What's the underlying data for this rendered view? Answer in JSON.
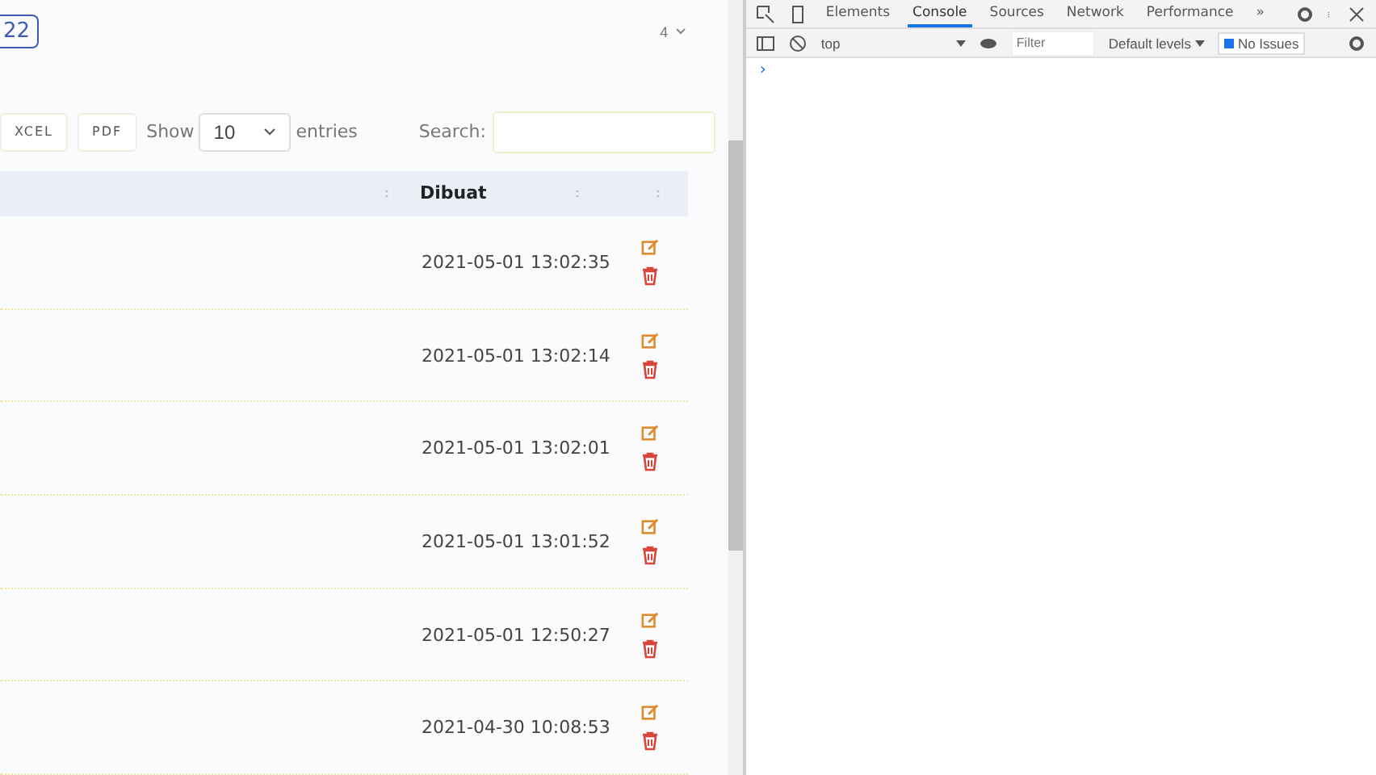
{
  "topbar": {
    "badge": "22",
    "user_menu": "4"
  },
  "toolbar": {
    "export_buttons": [
      "XCEL",
      "PDF"
    ],
    "show_label": "Show",
    "page_size": "10",
    "entries_label": "entries",
    "search_label": "Search:"
  },
  "table": {
    "columns": [
      "Dibuat"
    ],
    "rows": [
      {
        "dibuat": "2021-05-01 13:02:35"
      },
      {
        "dibuat": "2021-05-01 13:02:14"
      },
      {
        "dibuat": "2021-05-01 13:02:01"
      },
      {
        "dibuat": "2021-05-01 13:01:52"
      },
      {
        "dibuat": "2021-05-01 12:50:27"
      },
      {
        "dibuat": "2021-04-30 10:08:53"
      }
    ]
  },
  "devtools": {
    "tabs": [
      {
        "label": "Elements",
        "selected": false
      },
      {
        "label": "Console",
        "selected": true
      },
      {
        "label": "Sources",
        "selected": false
      },
      {
        "label": "Network",
        "selected": false
      },
      {
        "label": "Performance",
        "selected": false
      }
    ],
    "more": "»",
    "context": "top",
    "filter_placeholder": "Filter",
    "levels": "Default levels",
    "issues": "No Issues",
    "prompt": "›"
  }
}
